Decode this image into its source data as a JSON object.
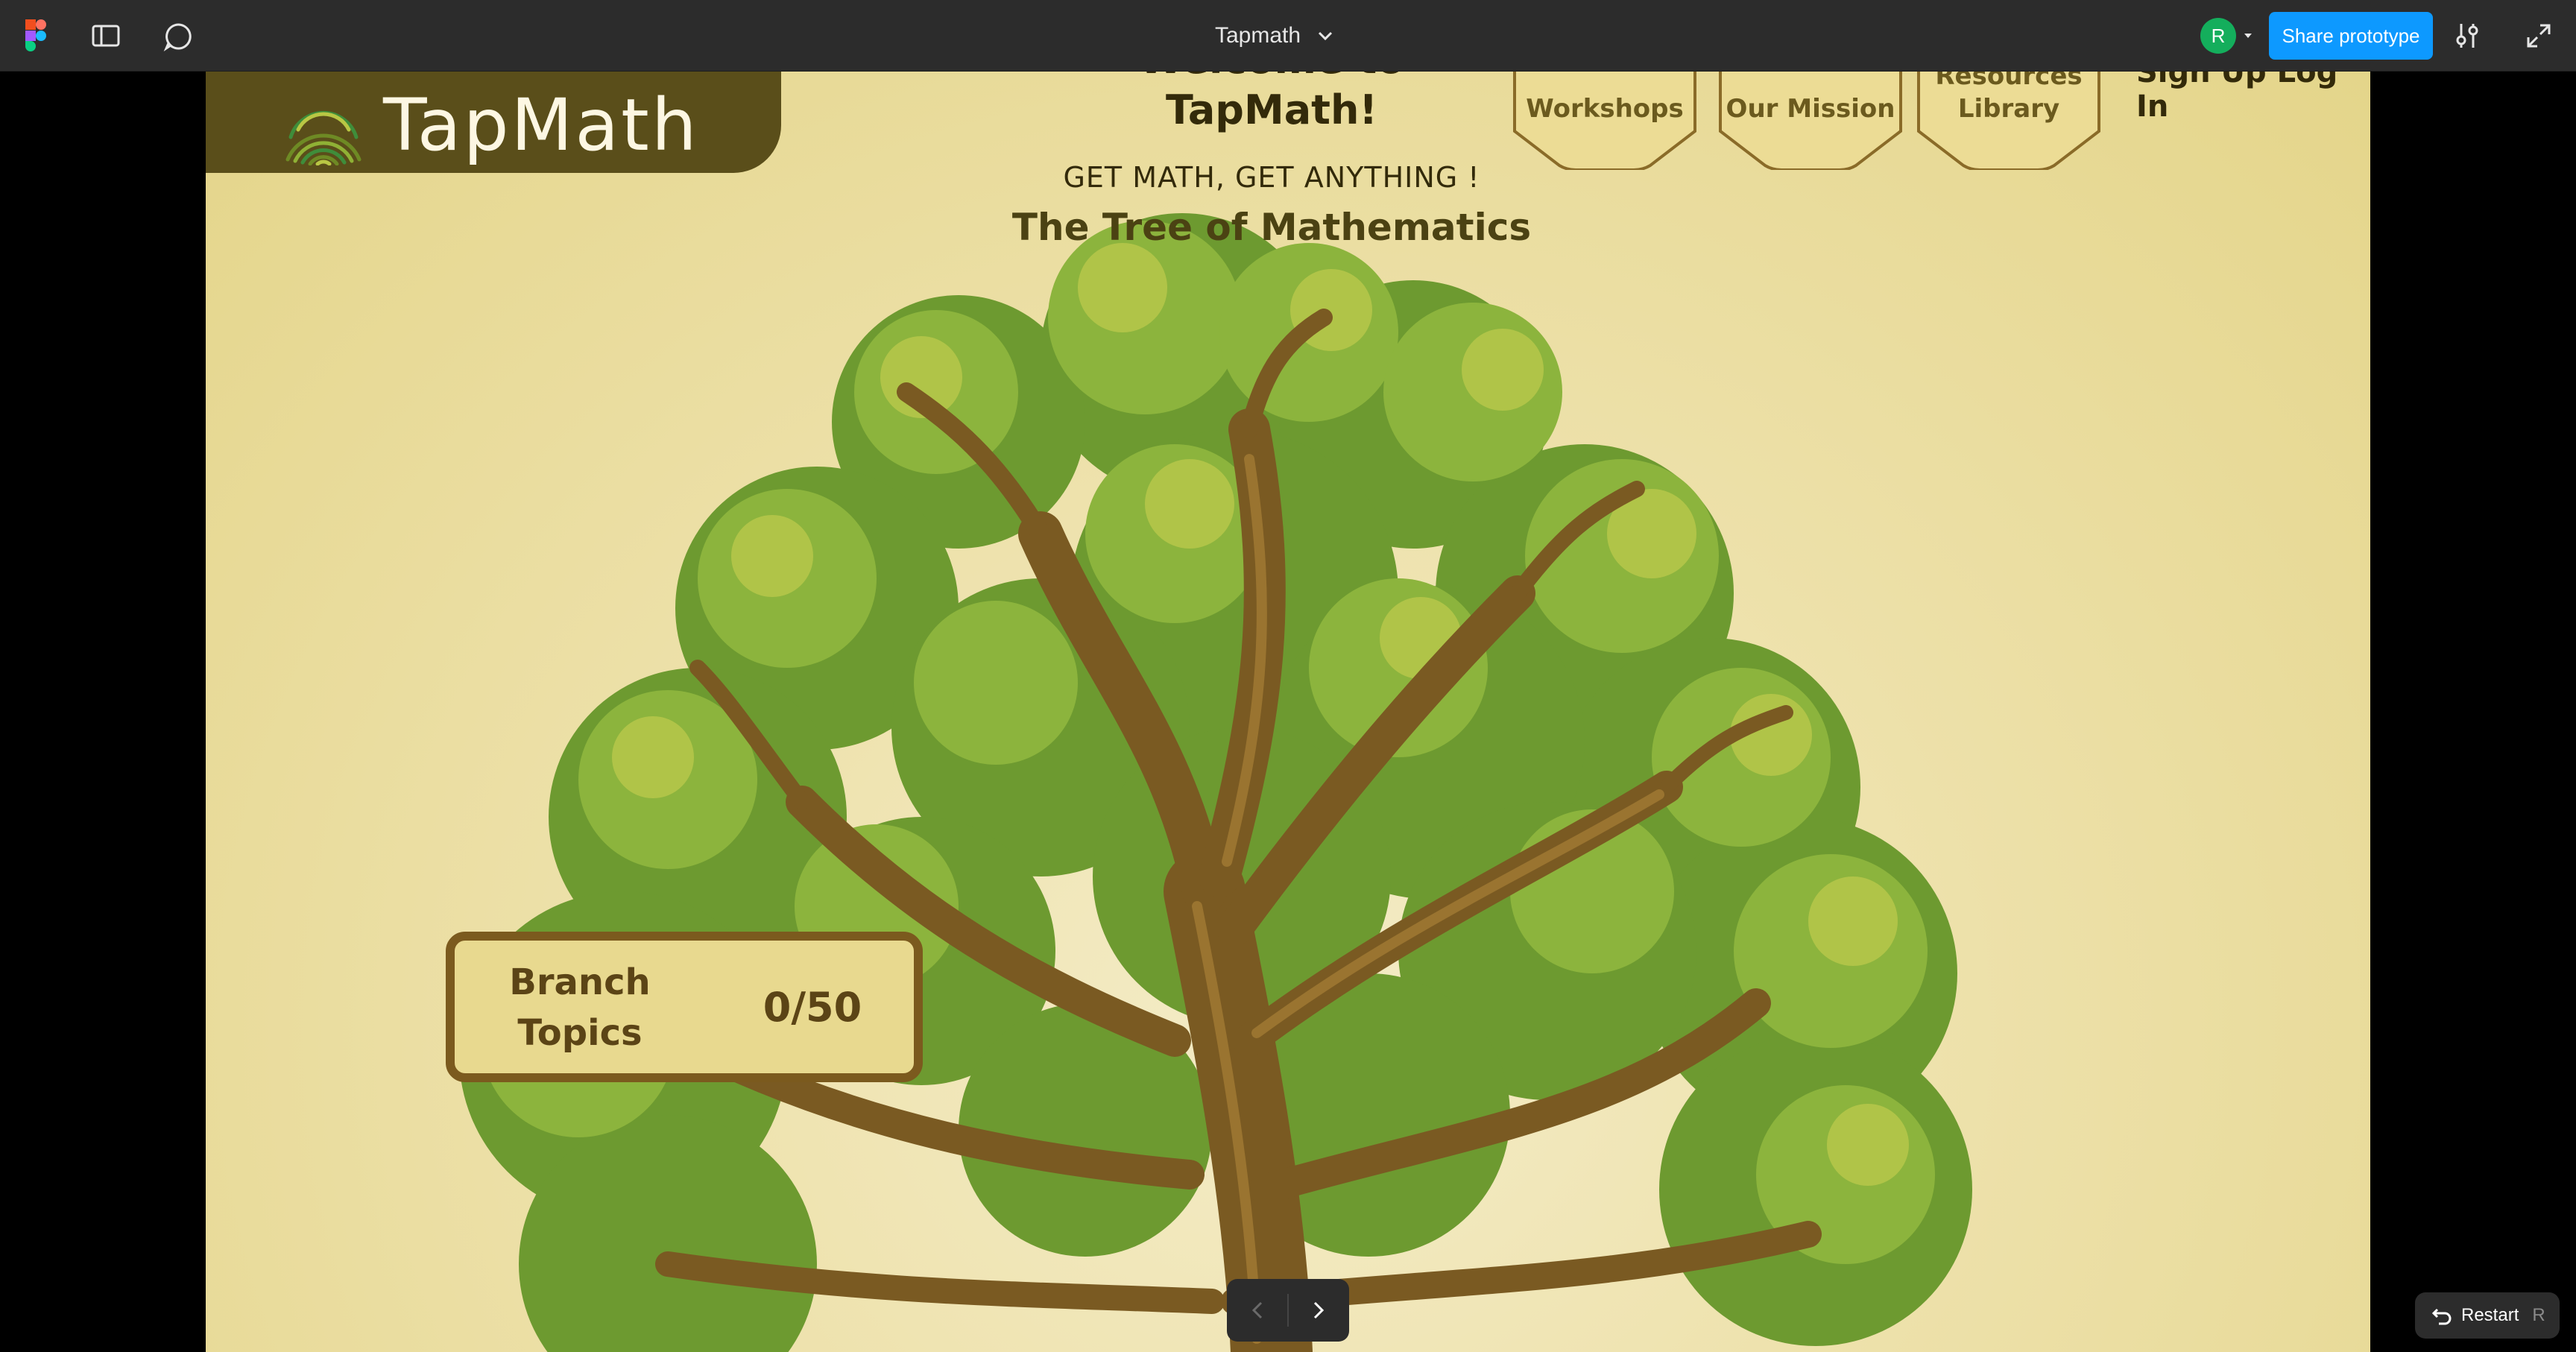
{
  "toolbar": {
    "file_title": "Tapmath",
    "avatar_initial": "R",
    "share_label": "Share prototype"
  },
  "page": {
    "logo_text": "TapMath",
    "welcome_line1": "Welcome to",
    "welcome_line2": "TapMath!",
    "tagline": "GET MATH, GET ANYTHING !",
    "tree_title": "The Tree of Mathematics",
    "nav": [
      {
        "label_lines": [
          "Workshops"
        ]
      },
      {
        "label_lines": [
          "Our Mission"
        ]
      },
      {
        "label_lines": [
          "Resources",
          "Library"
        ]
      }
    ],
    "nav_extra": "Sign Up Log In",
    "branch_label_line1": "Branch",
    "branch_label_line2": "Topics",
    "branch_count": "0/50"
  },
  "controls": {
    "restart_label": "Restart",
    "restart_shortcut": "R"
  },
  "colors": {
    "toolbar_bg": "#2c2c2c",
    "share_blue": "#0d99ff",
    "avatar_green": "#14ae5c",
    "frame_bg": "#eee2ad",
    "logo_box": "#5a4e1a",
    "branch_border": "#7b5a1e",
    "foliage": "#7aa83a",
    "trunk": "#7a5a22"
  }
}
